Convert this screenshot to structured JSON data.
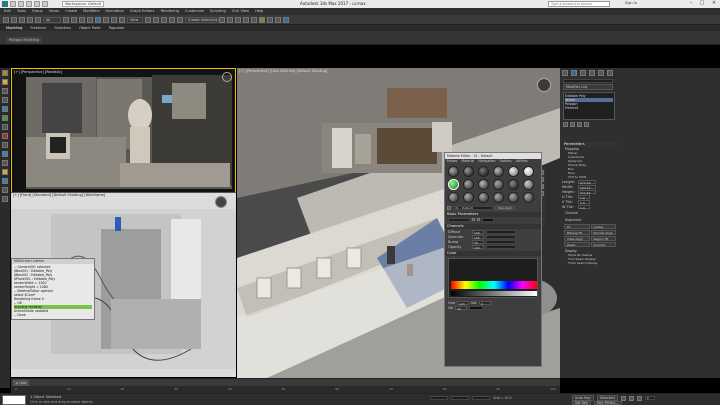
{
  "titlebar": {
    "title": "Autodesk 3ds Max 2017 - ui.max",
    "workspace": "Workspaces: Default",
    "search_placeholder": "Type a keyword or phrase",
    "signin": "Sign In"
  },
  "menubar": [
    "Edit",
    "Tools",
    "Group",
    "Views",
    "Create",
    "Modifiers",
    "Animation",
    "Graph Editors",
    "Rendering",
    "Customize",
    "Scripting",
    "Civil View",
    "Help"
  ],
  "toolbar": {
    "selection_filter": "All",
    "view_label": "View",
    "create_set": "Create Selection Se"
  },
  "ribbon": {
    "tabs": [
      "Modeling",
      "Freeform",
      "Selection",
      "Object Paint",
      "Populate"
    ],
    "panel_label": "Polygon Modeling"
  },
  "viewports": {
    "top_left_label": "[+] [Perspective] [Realistic]",
    "bottom_left_label": "[+] [Front] [Standard] [Default Shading] [Wireframe]",
    "right_label": "[+] [Perspective] [User Defined] [Default Shading]"
  },
  "script_window": {
    "title": "MAXScript Listener",
    "lines": [
      "-- Camera001 selected",
      "$Box001 : Editable_Poly",
      "$Box002 : Editable_Poly",
      "$Plane001 : Editable_Poly",
      "renderWidth = 1920",
      "renderHeight = 1080",
      "-- MaterialEditor opened",
      "select $Cam*",
      "Rendering frame 0",
      "-- OK",
      "Scanline renderer",
      "ActiveShade updated",
      "-- Done"
    ]
  },
  "material_editor": {
    "title": "Material Editor - 01 - Default",
    "menu": [
      "Modes",
      "Material",
      "Navigation",
      "Options",
      "Utilities"
    ],
    "material_name": "01 - Default",
    "material_type": "Standard",
    "sections": [
      "Basic Parameters",
      "Channels",
      "Color"
    ],
    "channels": [
      "Diffuse",
      "Specular",
      "Bump",
      "Opacity"
    ],
    "channel_values": [
      "100",
      "100",
      "30",
      "100"
    ],
    "hue_label": "Hue",
    "sat_label": "Sat",
    "val_label": "Val",
    "hsv": [
      "120",
      "0",
      "96"
    ]
  },
  "command_panel": {
    "modifier_list": "Modifier List",
    "stack": [
      "Editable Poly",
      "Vertex",
      "Polygon",
      "Element"
    ],
    "sections": [
      "Parameters",
      "Mapping",
      "Channel",
      "Alignment",
      "Display"
    ],
    "mapping_options": [
      "Planar",
      "Cylindrical",
      "Spherical",
      "Shrink Wrap",
      "Box",
      "Face",
      "XYZ to UVW"
    ],
    "fields": [
      "Length:",
      "Width:",
      "Height:",
      "U Tile:",
      "V Tile:",
      "W Tile:"
    ],
    "values": [
      "271.52",
      "164.53",
      "271.52",
      "1.0",
      "1.0",
      "1.0"
    ],
    "buttons": [
      "Fit",
      "Center",
      "Bitmap Fit",
      "Normal Align",
      "View Align",
      "Region Fit",
      "Reset",
      "Acquire"
    ],
    "display_opts": [
      "Show No Seams",
      "Thin Seam Display",
      "Thick Seam Display"
    ]
  },
  "timeline": {
    "frame": "0 / 100",
    "ticks": [
      "0",
      "10",
      "20",
      "30",
      "40",
      "50",
      "60",
      "70",
      "80",
      "90",
      "100"
    ]
  },
  "status": {
    "selected": "1 Object Selected",
    "hint": "Click or click-and-drag to select objects",
    "grid": "Grid = 10.0",
    "autokey": "Auto Key",
    "selected_btn": "Selected",
    "setkey": "Set Key",
    "key_filters": "Key Filters...",
    "time": "0"
  }
}
